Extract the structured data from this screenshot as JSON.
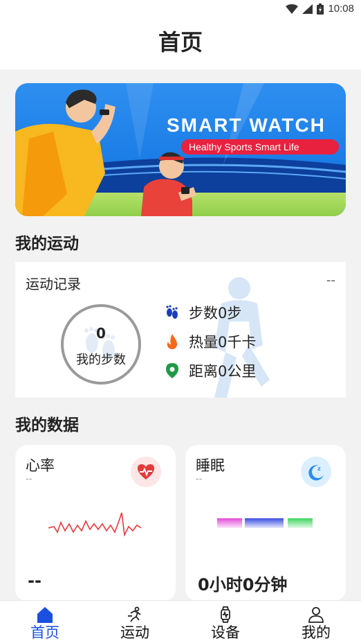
{
  "status_bar": {
    "time": "10:08"
  },
  "header": {
    "title": "首页"
  },
  "banner": {
    "headline": "SMART WATCH",
    "tagline": "Healthy Sports Smart Life"
  },
  "my_sport": {
    "section_title": "我的运动",
    "card_title": "运动记录",
    "more": "--",
    "steps_value": "0",
    "steps_label": "我的步数",
    "stats": [
      {
        "icon": "footprint-icon",
        "text": "步数0步"
      },
      {
        "icon": "flame-icon",
        "text": "热量0千卡"
      },
      {
        "icon": "location-pin-icon",
        "text": "距离0公里"
      }
    ]
  },
  "my_data": {
    "section_title": "我的数据",
    "heart_rate": {
      "title": "心率",
      "sub": "--",
      "value": "--",
      "icon": "heart-rate-icon"
    },
    "sleep": {
      "title": "睡眠",
      "sub": "--",
      "value": "0小时0分钟",
      "icon": "sleep-moon-icon"
    }
  },
  "tabs": [
    {
      "label": "首页",
      "icon": "home-icon",
      "active": true
    },
    {
      "label": "运动",
      "icon": "running-icon",
      "active": false
    },
    {
      "label": "设备",
      "icon": "watch-icon",
      "active": false
    },
    {
      "label": "我的",
      "icon": "user-icon",
      "active": false
    }
  ],
  "colors": {
    "accent": "#1a4fe0",
    "heart": "#e43a3a",
    "flame": "#f26a1b",
    "pin": "#1f9a45",
    "sleep": "#2a8ef0"
  }
}
